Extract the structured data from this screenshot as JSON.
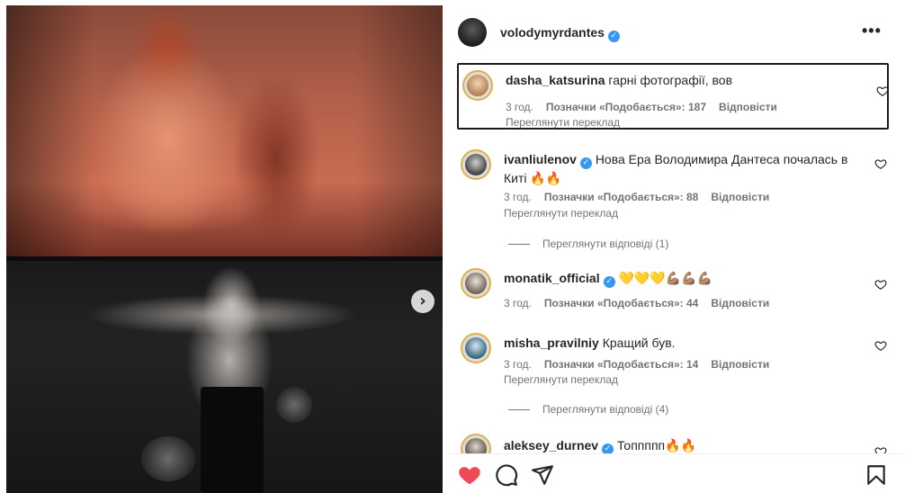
{
  "post": {
    "author": "volodymyrdantes",
    "more_label": "•••",
    "media_next_label": "›"
  },
  "comments": [
    {
      "username": "dasha_katsurina",
      "verified": false,
      "text": "гарні фотографії, вов",
      "time": "3 год.",
      "likes_label": "Позначки «Подобається»: 187",
      "reply_label": "Відповісти",
      "translate_label": "Переглянути переклад"
    },
    {
      "username": "ivanliulenov",
      "verified": true,
      "text": "Нова Ера Володимира Дантеса почалась в Киті 🔥🔥",
      "time": "3 год.",
      "likes_label": "Позначки «Подобається»: 88",
      "reply_label": "Відповісти",
      "translate_label": "Переглянути переклад",
      "replies_label": "Переглянути відповіді (1)"
    },
    {
      "username": "monatik_official",
      "verified": true,
      "text": "💛💛💛💪🏽💪🏽💪🏽",
      "time": "3 год.",
      "likes_label": "Позначки «Подобається»: 44",
      "reply_label": "Відповісти"
    },
    {
      "username": "misha_pravilniy",
      "verified": false,
      "text": "Кращий був.",
      "time": "3 год.",
      "likes_label": "Позначки «Подобається»: 14",
      "reply_label": "Відповісти",
      "translate_label": "Переглянути переклад",
      "replies_label": "Переглянути відповіді (4)"
    },
    {
      "username": "aleksey_durnev",
      "verified": true,
      "text": "Топпппп🔥🔥"
    }
  ],
  "icons": {
    "like": "heart-filled-icon",
    "comment": "comment-bubble-icon",
    "share": "paper-plane-icon",
    "save": "bookmark-icon",
    "comment_like": "heart-outline-icon",
    "verified": "verified-badge-icon",
    "more": "more-options-icon",
    "next": "chevron-right-icon"
  },
  "colors": {
    "like_active": "#ed4956",
    "verified": "#3897f0",
    "meta_text": "#737373",
    "primary_text": "#262626",
    "story_ring": "#e2b04a"
  }
}
